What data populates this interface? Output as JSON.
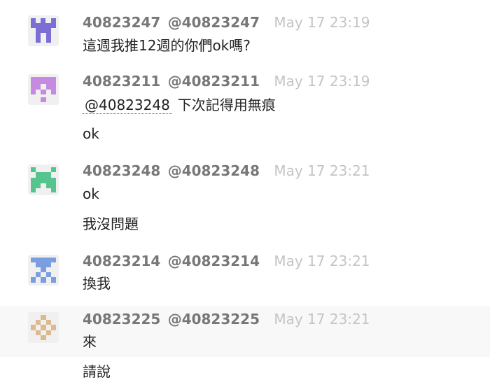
{
  "messages": [
    {
      "username": "40823247",
      "handle": "@40823247",
      "time": "May 17 23:19",
      "lines": [
        "這週我推12週的你們ok嗎?"
      ]
    },
    {
      "username": "40823211",
      "handle": "@40823211",
      "time": "May 17 23:19",
      "mention": "@40823248",
      "lines": [
        "下次記得用無痕",
        "ok"
      ]
    },
    {
      "username": "40823248",
      "handle": "@40823248",
      "time": "May 17 23:21",
      "lines": [
        "ok",
        "我沒問題"
      ]
    },
    {
      "username": "40823214",
      "handle": "@40823214",
      "time": "May 17 23:21",
      "lines": [
        "換我"
      ]
    },
    {
      "username": "40823225",
      "handle": "@40823225",
      "time": "May 17 23:21",
      "lines": [
        "來",
        "請說"
      ]
    }
  ],
  "colors": {
    "avatar_1": "#7b6fd6",
    "avatar_2": "#c48be0",
    "avatar_3": "#55c48e",
    "avatar_4": "#7a9ee0",
    "avatar_5": "#dcb98f",
    "username": "#777777",
    "timestamp": "#c4c4c4",
    "text": "#222222",
    "hover_row": "#f8f8f8"
  },
  "icons": [
    "identicon-avatar"
  ]
}
